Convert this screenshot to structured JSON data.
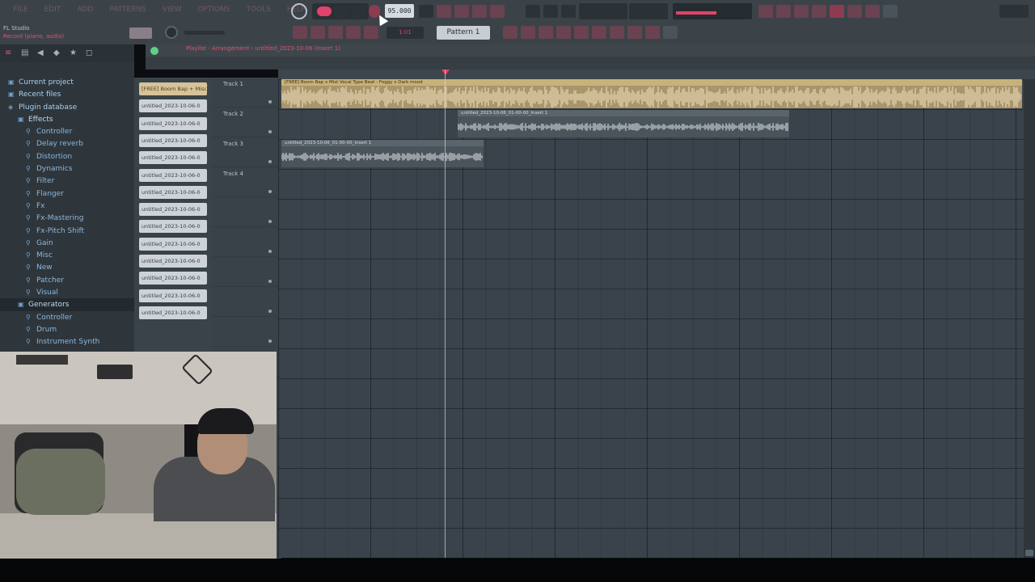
{
  "toolbar": {
    "app_title": "FL Studio",
    "app_subtitle": "Record (piano, audio)",
    "tempo": "95.000",
    "pattern": "Pattern 1",
    "pattern_number": "1:01",
    "menu": [
      "FILE",
      "EDIT",
      "ADD",
      "PATTERNS",
      "VIEW",
      "OPTIONS",
      "TOOLS",
      "HELP"
    ]
  },
  "playlist": {
    "title": "Playlist - Arrangement › untitled_2023-10-06 (Insert 1)",
    "tracks": [
      "Track 1",
      "Track 2",
      "Track 3",
      "Track 4",
      "",
      "",
      "",
      "",
      "",
      "",
      "",
      "",
      "",
      "",
      "",
      ""
    ]
  },
  "browser": {
    "items": [
      {
        "label": "Current project",
        "type": "top",
        "icon": "folder-icon"
      },
      {
        "label": "Recent files",
        "type": "top",
        "icon": "folder-icon"
      },
      {
        "label": "Plugin database",
        "type": "top",
        "icon": "database-icon"
      },
      {
        "label": "Effects",
        "type": "folder",
        "icon": "folder-icon"
      },
      {
        "label": "Controller",
        "type": "item",
        "icon": "plugin-icon"
      },
      {
        "label": "Delay reverb",
        "type": "item",
        "icon": "plugin-icon"
      },
      {
        "label": "Distortion",
        "type": "item",
        "icon": "plugin-icon"
      },
      {
        "label": "Dynamics",
        "type": "item",
        "icon": "plugin-icon"
      },
      {
        "label": "Filter",
        "type": "item",
        "icon": "plugin-icon"
      },
      {
        "label": "Flanger",
        "type": "item",
        "icon": "plugin-icon"
      },
      {
        "label": "Fx",
        "type": "item",
        "icon": "plugin-icon"
      },
      {
        "label": "Fx-Mastering",
        "type": "item",
        "icon": "plugin-icon"
      },
      {
        "label": "Fx-Pitch Shift",
        "type": "item",
        "icon": "plugin-icon"
      },
      {
        "label": "Gain",
        "type": "item",
        "icon": "plugin-icon"
      },
      {
        "label": "Misc",
        "type": "item",
        "icon": "plugin-icon"
      },
      {
        "label": "New",
        "type": "item",
        "icon": "plugin-icon"
      },
      {
        "label": "Patcher",
        "type": "item",
        "icon": "plugin-icon"
      },
      {
        "label": "Visual",
        "type": "item",
        "icon": "plugin-icon"
      },
      {
        "label": "Generators",
        "type": "folder",
        "icon": "folder-icon"
      },
      {
        "label": "Controller",
        "type": "item",
        "icon": "plugin-icon"
      },
      {
        "label": "Drum",
        "type": "item",
        "icon": "plugin-icon"
      },
      {
        "label": "Instrument Synth",
        "type": "item",
        "icon": "plugin-icon"
      }
    ]
  },
  "clips": {
    "list": [
      "[FREE] Boom Bap + Mist",
      "untitled_2023-10-06-0",
      "untitled_2023-10-06-0",
      "untitled_2023-10-06-0",
      "untitled_2023-10-06-0",
      "untitled_2023-10-06-0",
      "untitled_2023-10-06-0",
      "untitled_2023-10-06-0",
      "untitled_2023-10-06-0",
      "untitled_2023-10-06-0",
      "untitled_2023-10-06-0",
      "untitled_2023-10-06-0",
      "untitled_2023-10-06-0",
      "untitled_2023-10-06-0"
    ],
    "beat_clip_name": "[FREE] Boom Bap x Mist Vocal Type Beat - Foggy x Dark mood",
    "vocal_clip_1_name": "untitled_2023-10-06_01-00-00_Insert 1",
    "vocal_clip_2_name": "untitled_2023-10-06_01-00-00_Insert 1"
  },
  "colors": {
    "accent": "#e0436b",
    "beat_clip": "#c9b27a",
    "grid": "#3a434b"
  }
}
